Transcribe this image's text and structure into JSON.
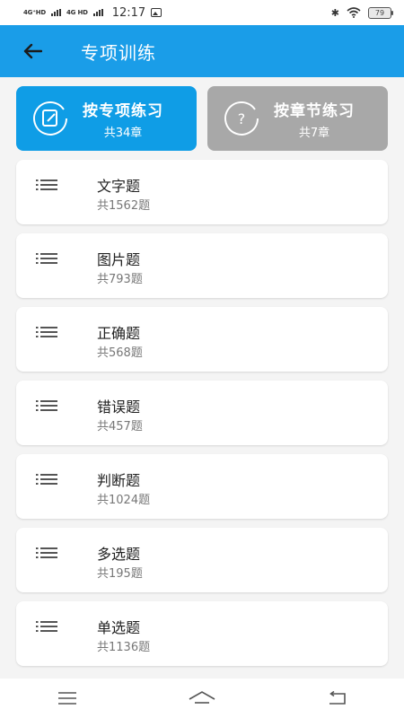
{
  "status_bar": {
    "network_1": "4G⁺HD",
    "network_2": "4G HD",
    "time": "12:17",
    "battery": "79"
  },
  "app_bar": {
    "title": "专项训练",
    "back_icon": "arrow-left-icon"
  },
  "modes": [
    {
      "title": "按专项练习",
      "subtitle": "共34章",
      "icon": "edit-circle-icon",
      "color": "#0f9de6",
      "selected": true
    },
    {
      "title": "按章节练习",
      "subtitle": "共7章",
      "icon": "question-circle-icon",
      "color": "#a8a8a8",
      "selected": false
    }
  ],
  "items": [
    {
      "title": "文字题",
      "count": "共1562题"
    },
    {
      "title": "图片题",
      "count": "共793题"
    },
    {
      "title": "正确题",
      "count": "共568题"
    },
    {
      "title": "错误题",
      "count": "共457题"
    },
    {
      "title": "判断题",
      "count": "共1024题"
    },
    {
      "title": "多选题",
      "count": "共195题"
    },
    {
      "title": "单选题",
      "count": "共1136题"
    }
  ],
  "nav_bar": {
    "menu_icon": "menu-icon",
    "home_icon": "home-icon",
    "back_icon": "back-return-icon"
  },
  "colors": {
    "primary": "#1a9de8",
    "inactive": "#a8a8a8"
  }
}
